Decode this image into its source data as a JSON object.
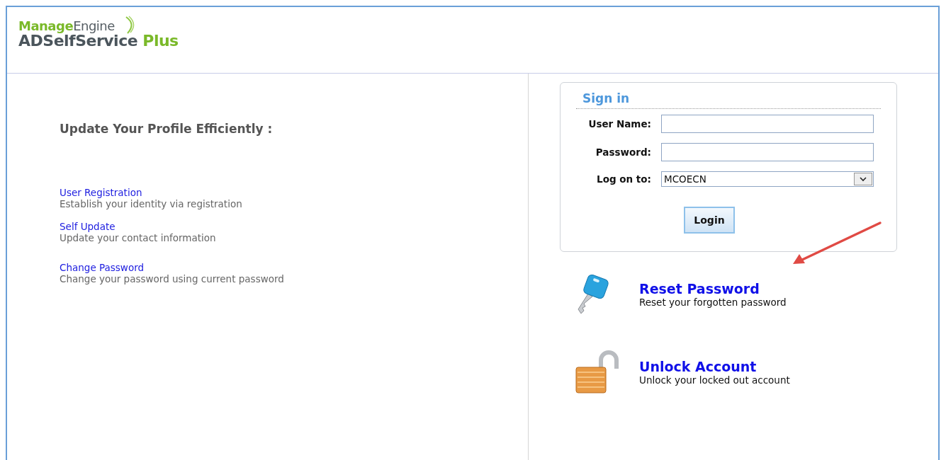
{
  "header": {
    "brand": "**Manage**Engine",
    "product": "ADSelfService **Plus**"
  },
  "profile": {
    "heading": "Update Your Profile Efficiently :",
    "links": [
      {
        "title": "User Registration",
        "description": "Establish your identity via registration"
      },
      {
        "title": "Self Update",
        "description": "Update your contact information"
      },
      {
        "title": "Change Password",
        "description": "Change your password using current password"
      }
    ]
  },
  "sign_in": {
    "title": "Sign in",
    "fields": [
      {
        "kind": "text",
        "label": "User Name:"
      },
      {
        "kind": "password",
        "label": "Password:"
      },
      {
        "kind": "select",
        "label": "Log on to:",
        "value": "MCOECN"
      }
    ],
    "button": "Login"
  },
  "actions": [
    {
      "kind": "key",
      "title": "Reset Password",
      "description": "Reset your forgotten password"
    },
    {
      "kind": "lock",
      "title": "Unlock Account",
      "description": "Unlock your locked out account"
    }
  ]
}
